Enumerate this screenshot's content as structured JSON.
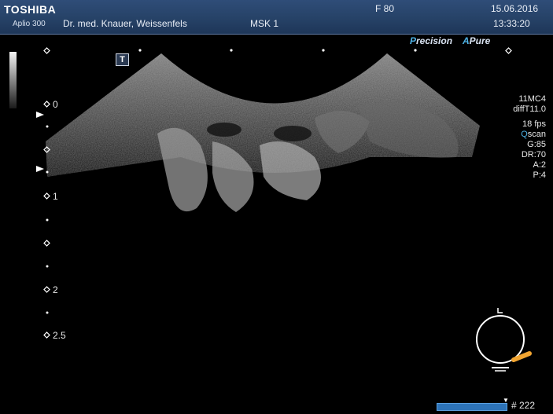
{
  "header": {
    "brand": "TOSHIBA",
    "model": "Aplio 300",
    "institution": "Dr. med. Knauer, Weissenfels",
    "preset": "MSK 1",
    "frame_rate": "F  80",
    "date": "15.06.2016",
    "time": "13:33:20"
  },
  "badges": {
    "precision": {
      "accent": "P",
      "rest": "recision"
    },
    "pure": {
      "accent": "A",
      "rest": "Pure"
    }
  },
  "overlay": {
    "t_icon": "T"
  },
  "depth_scale": {
    "labels": [
      "0",
      "1",
      "2",
      "2.5"
    ]
  },
  "params": {
    "probe": "11MC4",
    "mode": "diffT11.0",
    "fps": "18 fps",
    "qscan_accent": "Q",
    "qscan_rest": "scan",
    "gain": "G:85",
    "dynamic_range": "DR:70",
    "a": "A:2",
    "p": "P:4"
  },
  "cine": {
    "frame_count": "# 222",
    "marker": "▼"
  },
  "colors": {
    "header_bg": "#264267",
    "accent_blue": "#4fb3e6",
    "probe_marker": "#f2a531",
    "cine_bar": "#2d73b8"
  }
}
